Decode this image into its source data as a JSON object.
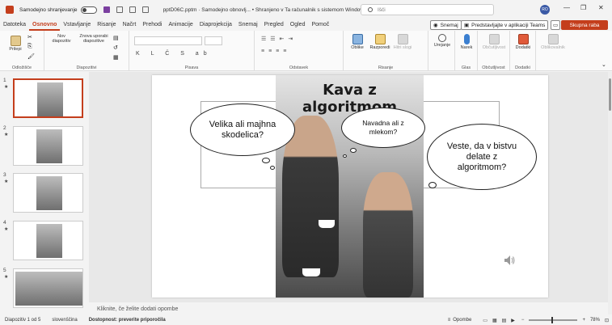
{
  "titlebar": {
    "autosave_label": "Samodejno shranjevanje",
    "filename": "pptD06C.pptm · Samodejno obnovlj... • Shranjeno v Ta računalnik s sistemom Windows",
    "search_placeholder": "Išči",
    "avatar_initials": "RO"
  },
  "menu": {
    "tabs": [
      "Datoteka",
      "Osnovno",
      "Vstavljanje",
      "Risanje",
      "Načrt",
      "Prehodi",
      "Animacije",
      "Diaprojekcija",
      "Snemaj",
      "Pregled",
      "Ogled",
      "Pomoč"
    ],
    "record_label": "Snemaj",
    "teams_label": "Predstavljajte v aplikaciji Teams",
    "share_label": "Skupna raba"
  },
  "ribbon": {
    "paste": "Prilepi",
    "new_slide": "Nov diapozitiv",
    "reuse_slides": "Znova uporabi diapozitive",
    "shapes": "Oblike",
    "arrange": "Razporedi",
    "quick_styles": "Hitri slogi",
    "editing": "Urejanje",
    "dictate": "Narek",
    "sensitivity": "Občutljivost",
    "addins": "Dodatki",
    "designer": "Oblikovalnik",
    "groups": {
      "clipboard": "Odložišče",
      "slides": "Diapozitivi",
      "font": "Pisava",
      "paragraph": "Odstavek",
      "drawing": "Risanje",
      "voice": "Glas",
      "sensitivity": "Občutljivost",
      "addins": "Dodatki"
    }
  },
  "thumbnails": [
    {
      "num": "1"
    },
    {
      "num": "2"
    },
    {
      "num": "3"
    },
    {
      "num": "4"
    },
    {
      "num": "5"
    }
  ],
  "slide": {
    "title": "Kava z algoritmom",
    "bubble1": "Velika ali majhna skodelica?",
    "bubble2": "Navadna ali z mlekom?",
    "bubble3": "Veste, da v bistvu delate z algoritmom?"
  },
  "notes_placeholder": "Kliknite, če želite dodati opombe",
  "status": {
    "slide_count": "Diapozitiv 1 od 5",
    "language": "slovenščina",
    "accessibility": "Dostopnost: preverite priporočila",
    "notes": "Opombe",
    "zoom": "78%"
  }
}
